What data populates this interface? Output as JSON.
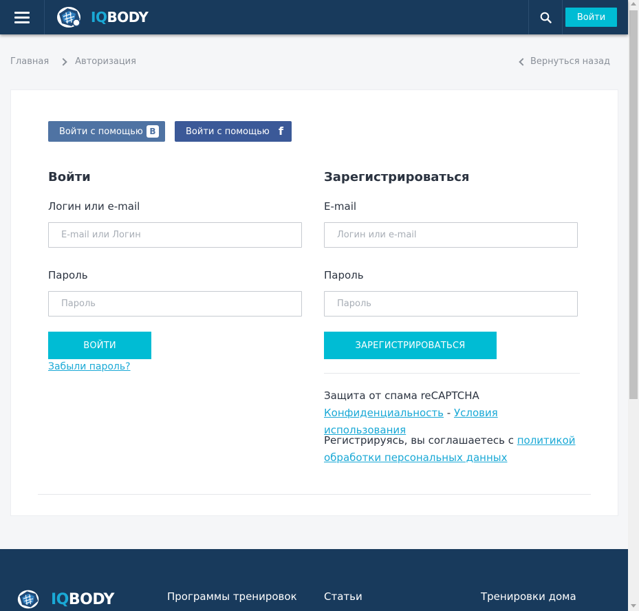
{
  "header": {
    "logo_iq": "IQ",
    "logo_body": "BODY",
    "login_label": "Войти"
  },
  "breadcrumb": {
    "home": "Главная",
    "current": "Авторизация",
    "back": "Вернуться назад"
  },
  "social": {
    "vk_label": "Войти с помощью",
    "vk_letter": "B",
    "fb_label": "Войти с помощью",
    "fb_letter": "f"
  },
  "login": {
    "title": "Войти",
    "login_label": "Логин или e-mail",
    "login_placeholder": "E-mail или Логин",
    "password_label": "Пароль",
    "password_placeholder": "Пароль",
    "submit": "ВОЙТИ",
    "forgot": "Забыли пароль?"
  },
  "register": {
    "title": "Зарегистрироваться",
    "email_label": "E-mail",
    "email_placeholder": "Логин или e-mail",
    "password_label": "Пароль",
    "password_placeholder": "Пароль",
    "submit": "ЗАРЕГИСТРИРОВАТЬСЯ",
    "recaptcha_text": "Защита от спама reCAPTCHA",
    "privacy_link": "Конфиденциальность",
    "dash": " - ",
    "terms_link": "Условия использования",
    "agree_text": "Регистрируясь, вы соглашаетесь с ",
    "policy_link": "политикой обработки персональных данных"
  },
  "footer": {
    "logo_iq": "IQ",
    "logo_body": "BODY",
    "col1": "Программы тренировок",
    "col2": "Статьи",
    "col3": "Тренировки дома"
  },
  "colors": {
    "header_bg": "#183a5c",
    "accent": "#00bcd4",
    "link": "#1aa9d6",
    "vk": "#4f73a3",
    "fb": "#3b5998"
  }
}
